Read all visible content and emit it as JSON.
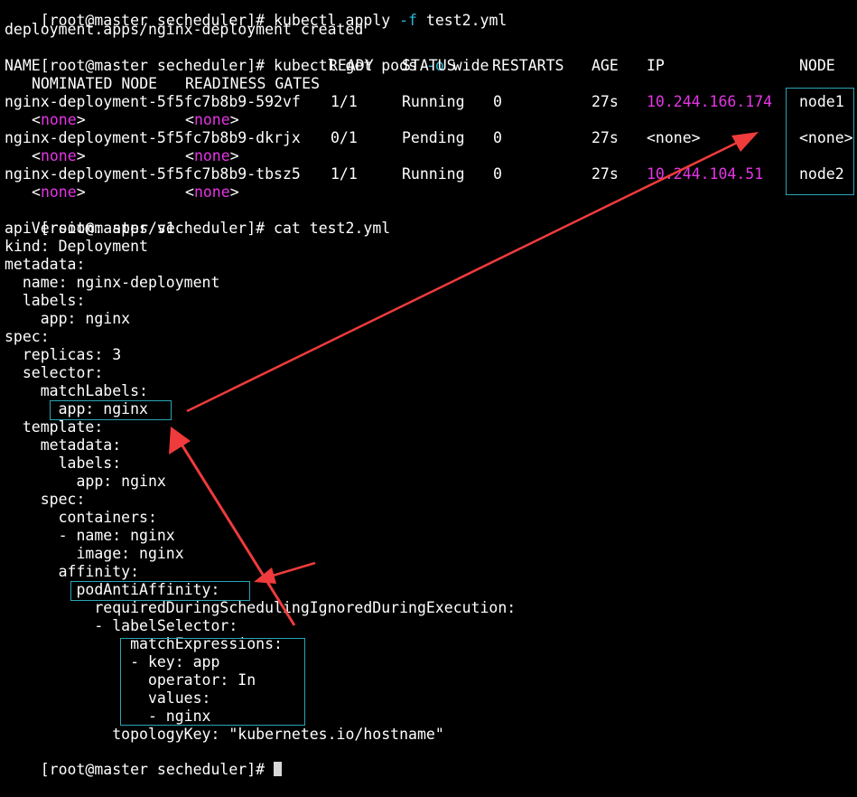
{
  "terminal": {
    "prompt": "[root@master secheduler]#",
    "commands": {
      "apply": "kubectl apply ",
      "apply_flag": "-f",
      "apply_arg": " test2.yml",
      "get": "kubectl get pods ",
      "get_flag": "-o",
      "get_arg": " wide",
      "cat": "cat test2.yml"
    },
    "apply_output": "deployment.apps/nginx-deployment created",
    "pods_table": {
      "headers": {
        "name": "NAME",
        "ready": "READY",
        "status": "STATUS",
        "restarts": "RESTARTS",
        "age": "AGE",
        "ip": "IP",
        "node": "NODE",
        "nominated_node": "NOMINATED NODE",
        "readiness_gates": "READINESS GATES"
      },
      "none_lt": "<",
      "none_word": "none",
      "none_gt": ">",
      "rows": [
        {
          "name": "nginx-deployment-5f5fc7b8b9-592vf",
          "ready": "1/1",
          "status": "Running",
          "restarts": "0",
          "age": "27s",
          "ip": "10.244.166.174",
          "node": "node1"
        },
        {
          "name": "nginx-deployment-5f5fc7b8b9-dkrjx",
          "ready": "0/1",
          "status": "Pending",
          "restarts": "0",
          "age": "27s",
          "ip": "<none>",
          "node": "<none>"
        },
        {
          "name": "nginx-deployment-5f5fc7b8b9-tbsz5",
          "ready": "1/1",
          "status": "Running",
          "restarts": "0",
          "age": "27s",
          "ip": "10.244.104.51",
          "node": "node2"
        }
      ]
    },
    "yaml_lines": [
      "apiVersion: apps/v1",
      "kind: Deployment",
      "metadata:",
      "  name: nginx-deployment",
      "  labels:",
      "    app: nginx",
      "spec:",
      "  replicas: 3",
      "  selector:",
      "    matchLabels:",
      "      app: nginx",
      "  template:",
      "    metadata:",
      "      labels:",
      "        app: nginx",
      "    spec:",
      "      containers:",
      "      - name: nginx",
      "        image: nginx",
      "      affinity:",
      "        podAntiAffinity:",
      "          requiredDuringSchedulingIgnoredDuringExecution:",
      "          - labelSelector:",
      "              matchExpressions:",
      "              - key: app",
      "                operator: In",
      "                values:",
      "                - nginx",
      "            topologyKey: \"kubernetes.io/hostname\""
    ],
    "colors": {
      "background": "#000000",
      "text": "#ffffff",
      "highlight_ip": "#e535e5",
      "flag": "#29b8d9",
      "annotation_box": "#2aa5b5",
      "annotation_arrow": "#ef3b3b"
    }
  }
}
